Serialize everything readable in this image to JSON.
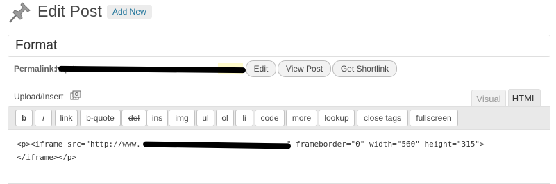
{
  "header": {
    "title": "Edit Post",
    "add_new_label": "Add New",
    "icon": "pushpin-icon"
  },
  "post": {
    "title_value": "Format"
  },
  "permalink": {
    "label": "Permalink:",
    "url_visible": "http://",
    "buttons": {
      "edit": "Edit",
      "view_post": "View Post",
      "get_shortlink": "Get Shortlink"
    }
  },
  "upload": {
    "label": "Upload/Insert",
    "icon": "media-gallery-icon"
  },
  "editor_tabs": {
    "visual": "Visual",
    "html": "HTML",
    "active": "HTML"
  },
  "quicktags": [
    "b",
    "i",
    "link",
    "b-quote",
    "del",
    "ins",
    "img",
    "ul",
    "ol",
    "li",
    "code",
    "more",
    "lookup",
    "close tags",
    "fullscreen"
  ],
  "content": {
    "line1_start": "<p><iframe src=\"http://www.",
    "line1_end": "\" frameborder=\"0\" width=\"560\" height=\"315\">",
    "line2": "</iframe></p>"
  },
  "colors": {
    "link_blue": "#21759b",
    "slug_highlight": "#fffbcc",
    "toolbar_bg": "#e9e9e9",
    "redaction": "#000000"
  }
}
